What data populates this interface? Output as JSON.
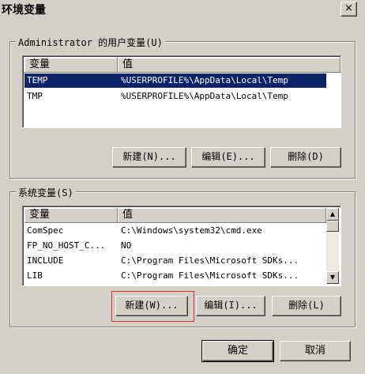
{
  "window": {
    "title": "环境变量",
    "close_glyph": "×"
  },
  "user_vars": {
    "group_label": "Administrator 的用户变量(U)",
    "columns": [
      "变量",
      "值"
    ],
    "rows": [
      {
        "name": "TEMP",
        "value": "%USERPROFILE%\\AppData\\Local\\Temp",
        "selected": true
      },
      {
        "name": "TMP",
        "value": "%USERPROFILE%\\AppData\\Local\\Temp",
        "selected": false
      }
    ],
    "buttons": {
      "new": "新建(N)...",
      "edit": "编辑(E)...",
      "delete": "删除(D)"
    }
  },
  "system_vars": {
    "group_label": "系统变量(S)",
    "columns": [
      "变量",
      "值"
    ],
    "rows": [
      {
        "name": "ComSpec",
        "value": "C:\\Windows\\system32\\cmd.exe"
      },
      {
        "name": "FP_NO_HOST_C...",
        "value": "NO"
      },
      {
        "name": "INCLUDE",
        "value": "C:\\Program Files\\Microsoft SDKs..."
      },
      {
        "name": "LIB",
        "value": "C:\\Program Files\\Microsoft SDKs..."
      }
    ],
    "scroll": {
      "up": "▲",
      "down": "▼"
    },
    "buttons": {
      "new": "新建(W)...",
      "edit": "编辑(I)...",
      "delete": "删除(L)"
    }
  },
  "dialog_buttons": {
    "ok": "确定",
    "cancel": "取消"
  },
  "colors": {
    "selection": "#0a246a",
    "annotation": "#e03030",
    "face": "#d4d0c8"
  }
}
